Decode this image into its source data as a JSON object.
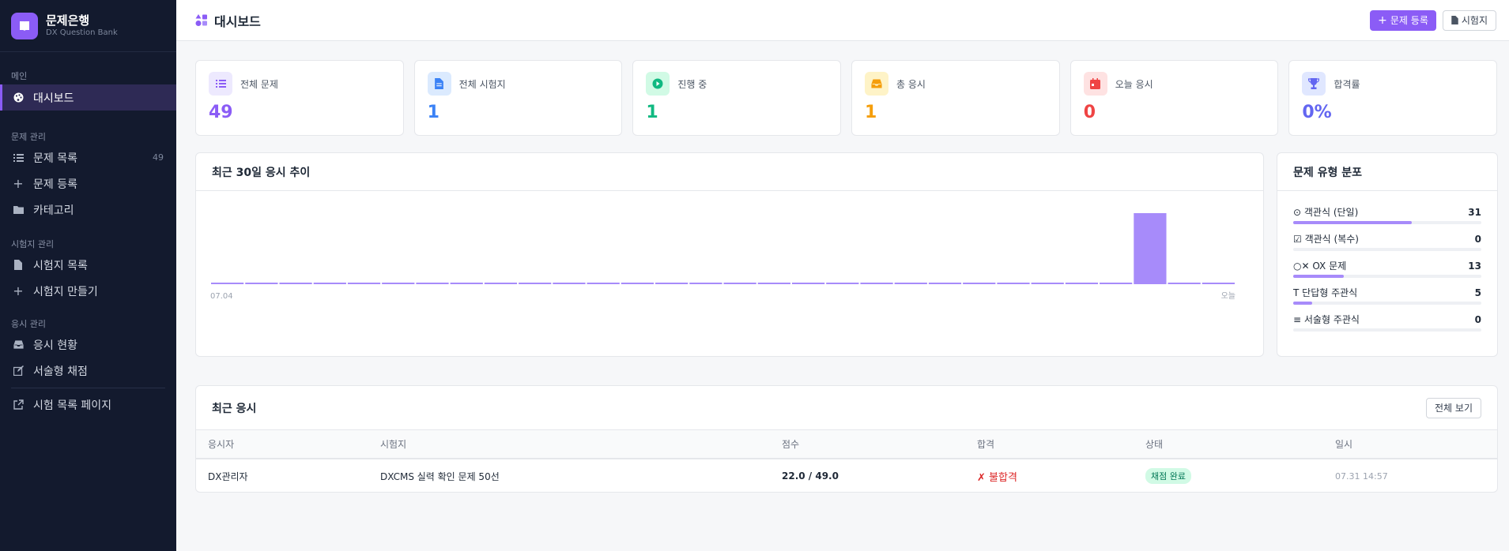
{
  "brand": {
    "title": "문제은행",
    "subtitle": "DX Question Bank"
  },
  "sidebar": {
    "sections": [
      {
        "label": "메인",
        "items": [
          {
            "label": "대시보드",
            "icon": "palette-icon",
            "active": true
          }
        ]
      },
      {
        "label": "문제 관리",
        "items": [
          {
            "label": "문제 목록",
            "icon": "list-icon",
            "badge": "49"
          },
          {
            "label": "문제 등록",
            "icon": "plus-icon"
          },
          {
            "label": "카테고리",
            "icon": "folder-icon"
          }
        ]
      },
      {
        "label": "시험지 관리",
        "items": [
          {
            "label": "시험지 목록",
            "icon": "file-icon"
          },
          {
            "label": "시험지 만들기",
            "icon": "plus-icon"
          }
        ]
      },
      {
        "label": "응시 관리",
        "items": [
          {
            "label": "응시 현황",
            "icon": "inbox-icon"
          },
          {
            "label": "서술형 채점",
            "icon": "edit-icon"
          }
        ]
      }
    ],
    "external": {
      "label": "시험 목록 페이지",
      "icon": "external-link-icon"
    }
  },
  "header": {
    "title": "대시보드",
    "add_question_label": "문제 등록",
    "exam_label": "시험지"
  },
  "stats": [
    {
      "label": "전체 문제",
      "value": "49",
      "color": "#8b5cf6",
      "bg": "#ede9fe",
      "icon": "list-icon"
    },
    {
      "label": "전체 시험지",
      "value": "1",
      "color": "#3b82f6",
      "bg": "#dbeafe",
      "icon": "file-icon"
    },
    {
      "label": "진행 중",
      "value": "1",
      "color": "#10b981",
      "bg": "#d1fae5",
      "icon": "play-icon"
    },
    {
      "label": "총 응시",
      "value": "1",
      "color": "#f59e0b",
      "bg": "#fef3c7",
      "icon": "inbox-icon"
    },
    {
      "label": "오늘 응시",
      "value": "0",
      "color": "#ef4444",
      "bg": "#fee2e2",
      "icon": "calendar-icon"
    },
    {
      "label": "합격률",
      "value": "0%",
      "color": "#6366f1",
      "bg": "#e0e7ff",
      "icon": "trophy-icon"
    }
  ],
  "trend": {
    "title": "최근 30일 응시 추이",
    "start_label": "07.04",
    "end_label": "오늘",
    "bar_color": "#a78bfa"
  },
  "chart_data": {
    "type": "bar",
    "values": [
      0,
      0,
      0,
      0,
      0,
      0,
      0,
      0,
      0,
      0,
      0,
      0,
      0,
      0,
      0,
      0,
      0,
      0,
      0,
      0,
      0,
      0,
      0,
      0,
      0,
      0,
      0,
      1,
      0,
      0
    ],
    "ylim": [
      0,
      1
    ]
  },
  "types": {
    "title": "문제 유형 분포",
    "items": [
      {
        "icon": "⊙",
        "label": "객관식 (단일)",
        "count": 31,
        "fraction": 0.63
      },
      {
        "icon": "☑",
        "label": "객관식 (복수)",
        "count": 0,
        "fraction": 0
      },
      {
        "icon": "○✕",
        "label": "OX 문제",
        "count": 13,
        "fraction": 0.27
      },
      {
        "icon": "T",
        "label": "단답형 주관식",
        "count": 5,
        "fraction": 0.1
      },
      {
        "icon": "≡",
        "label": "서술형 주관식",
        "count": 0,
        "fraction": 0
      }
    ]
  },
  "recent": {
    "title": "최근 응시",
    "view_all_label": "전체 보기",
    "columns": [
      "응시자",
      "시험지",
      "점수",
      "합격",
      "상태",
      "일시"
    ],
    "rows": [
      {
        "name": "DX관리자",
        "exam": "DXCMS 실력 확인 문제 50선",
        "score": "22.0 / 49.0",
        "pass_mark": "✗",
        "pass": "불합격",
        "status": "채점 완료",
        "date": "07.31 14:57"
      }
    ]
  }
}
